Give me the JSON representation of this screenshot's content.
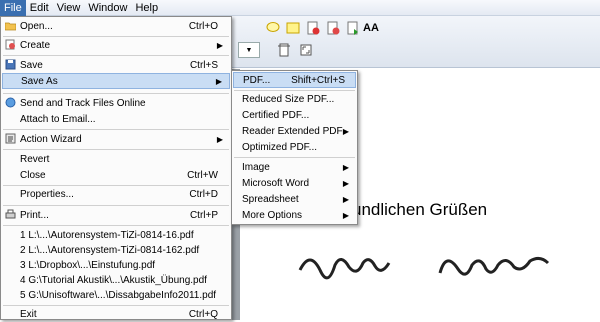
{
  "menubar": [
    "File",
    "Edit",
    "View",
    "Window",
    "Help"
  ],
  "file_menu": {
    "open": {
      "label": "Open...",
      "shortcut": "Ctrl+O"
    },
    "create": {
      "label": "Create"
    },
    "save": {
      "label": "Save",
      "shortcut": "Ctrl+S"
    },
    "save_as": {
      "label": "Save As"
    },
    "send_track": {
      "label": "Send and Track Files Online"
    },
    "attach_email": {
      "label": "Attach to Email..."
    },
    "action_wizard": {
      "label": "Action Wizard"
    },
    "revert": {
      "label": "Revert"
    },
    "close": {
      "label": "Close",
      "shortcut": "Ctrl+W"
    },
    "properties": {
      "label": "Properties...",
      "shortcut": "Ctrl+D"
    },
    "print": {
      "label": "Print...",
      "shortcut": "Ctrl+P"
    },
    "recent": [
      "1 L:\\...\\Autorensystem-TiZi-0814-16.pdf",
      "2 L:\\...\\Autorensystem-TiZi-0814-162.pdf",
      "3 L:\\Dropbox\\...\\Einstufung.pdf",
      "4 G:\\Tutorial Akustik\\...\\Akustik_Übung.pdf",
      "5 G:\\Unisoftware\\...\\DissabgabeInfo2011.pdf"
    ],
    "exit": {
      "label": "Exit",
      "shortcut": "Ctrl+Q"
    }
  },
  "save_as_menu": {
    "pdf": {
      "label": "PDF...",
      "shortcut": "Shift+Ctrl+S"
    },
    "reduced": "Reduced Size PDF...",
    "certified": "Certified PDF...",
    "reader_extended": "Reader Extended PDF",
    "optimized": "Optimized PDF...",
    "image": "Image",
    "word": "Microsoft Word",
    "spreadsheet": "Spreadsheet",
    "more": "More Options"
  },
  "document": {
    "greeting": "undlichen Grüßen"
  },
  "toolbar_font_label": "AA",
  "colors": {
    "menubar_active": "#3a6fb0",
    "highlight": "#c9ddf4"
  }
}
